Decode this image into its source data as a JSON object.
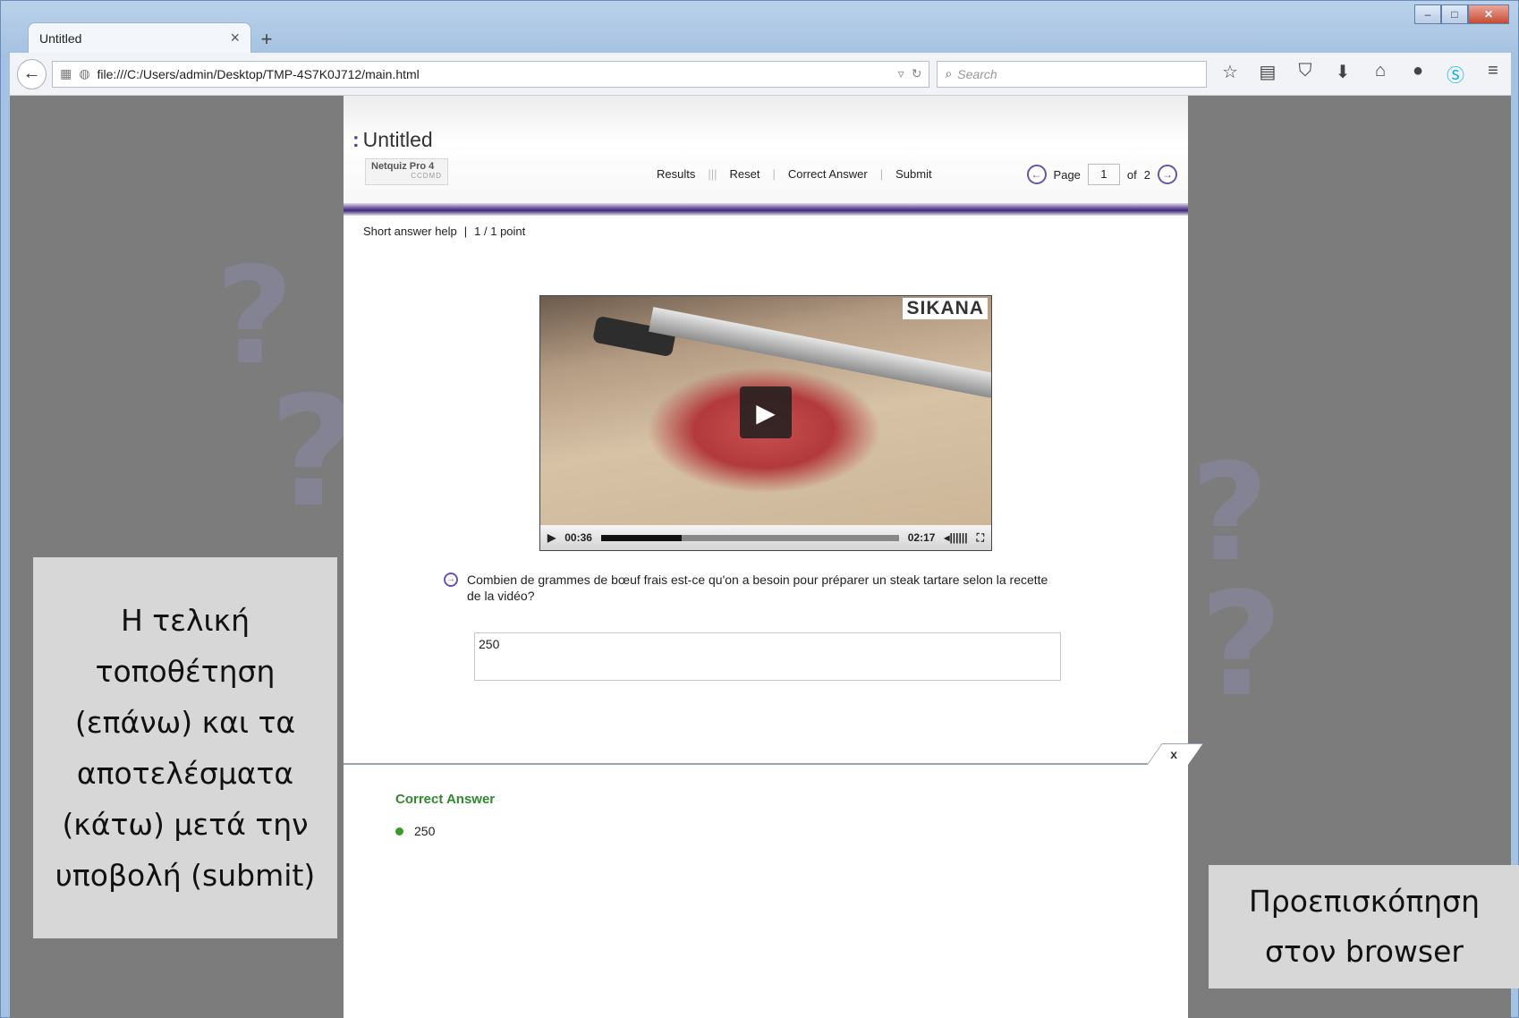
{
  "browser": {
    "tab_title": "Untitled",
    "tab_close": "×",
    "new_tab": "+",
    "url": "file:///C:/Users/admin/Desktop/TMP-4S7K0J712/main.html",
    "search_placeholder": "Search",
    "icons": [
      "back-arrow-icon",
      "reader-icon",
      "globe-icon",
      "reload-icon",
      "search-icon",
      "star-icon",
      "bookmarks-list-icon",
      "pocket-icon",
      "download-icon",
      "home-icon",
      "chat-icon",
      "skype-icon",
      "menu-icon"
    ]
  },
  "quiz": {
    "title": "Untitled",
    "brand_name": "Netquiz Pro 4",
    "brand_sub": "CCDMD",
    "actions": [
      "Results",
      "Reset",
      "Correct Answer",
      "Submit"
    ],
    "page_label": "Page",
    "page_current": "1",
    "page_of": "of",
    "page_total": "2",
    "help_label": "Short answer help",
    "points": "1 / 1 point",
    "video": {
      "logo": "SIKANA",
      "current_time": "00:36",
      "duration": "02:17",
      "progress": 0.27
    },
    "question": "Combien de grammes de bœuf frais est-ce qu'on a besoin pour préparer un steak tartare selon la recette de la vidéo?",
    "answer_value": "250",
    "feedback": {
      "close": "x",
      "title": "Correct Answer",
      "answer": "250"
    }
  },
  "captions": {
    "left": "Η τελική τοποθέτηση (επάνω) και τα αποτελέσματα (κάτω) μετά την υποβολή (submit)",
    "right": "Προεπισκόπηση στον browser"
  },
  "colors": {
    "accent_purple": "#6a55a5",
    "correct_green": "#2f8a2f"
  }
}
